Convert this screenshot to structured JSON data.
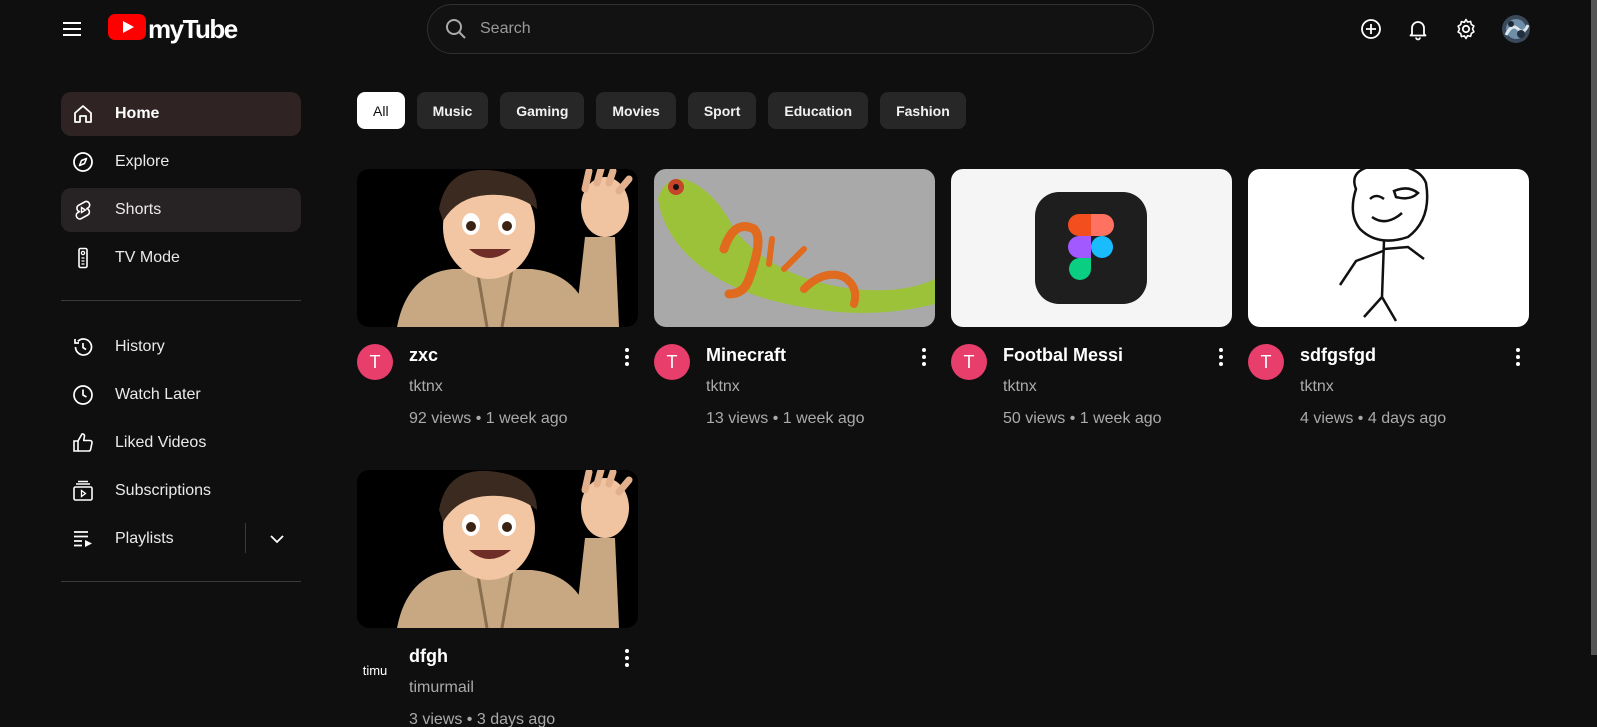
{
  "header": {
    "logo_text": "myTube",
    "search_placeholder": "Search",
    "icons": [
      "menu-icon",
      "logo-play-icon",
      "search-icon",
      "add-icon",
      "bell-icon",
      "gear-icon",
      "avatar"
    ]
  },
  "sidebar": {
    "primary": [
      {
        "label": "Home",
        "icon": "home-icon",
        "active": true
      },
      {
        "label": "Explore",
        "icon": "compass-icon"
      },
      {
        "label": "Shorts",
        "icon": "shorts-icon"
      },
      {
        "label": "TV Mode",
        "icon": "tv-remote-icon"
      }
    ],
    "secondary": [
      {
        "label": "History",
        "icon": "history-icon"
      },
      {
        "label": "Watch Later",
        "icon": "clock-icon"
      },
      {
        "label": "Liked Videos",
        "icon": "thumbs-up-icon"
      },
      {
        "label": "Subscriptions",
        "icon": "subscriptions-icon"
      },
      {
        "label": "Playlists",
        "icon": "playlist-icon"
      }
    ]
  },
  "chips": [
    "All",
    "Music",
    "Gaming",
    "Movies",
    "Sport",
    "Education",
    "Fashion"
  ],
  "videos": [
    {
      "title": "zxc",
      "channel": "tktnx",
      "meta": "92 views • 1 week ago",
      "avatar_letter": "T"
    },
    {
      "title": "Minecraft",
      "channel": "tktnx",
      "meta": "13 views • 1 week ago",
      "avatar_letter": "T"
    },
    {
      "title": "Footbal Messi",
      "channel": "tktnx",
      "meta": "50 views • 1 week ago",
      "avatar_letter": "T"
    },
    {
      "title": "sdfgsfgd",
      "channel": "tktnx",
      "meta": "4 views • 4 days ago",
      "avatar_letter": "T"
    },
    {
      "title": "dfgh",
      "channel": "timurmail",
      "meta": "3 views • 3 days ago",
      "avatar_letter": "timu"
    }
  ],
  "colors": {
    "background": "#0f0f0f",
    "logo_red": "#ff0000",
    "avatar_pink": "#e83e6c",
    "active_sidebar": "#2f2324"
  }
}
